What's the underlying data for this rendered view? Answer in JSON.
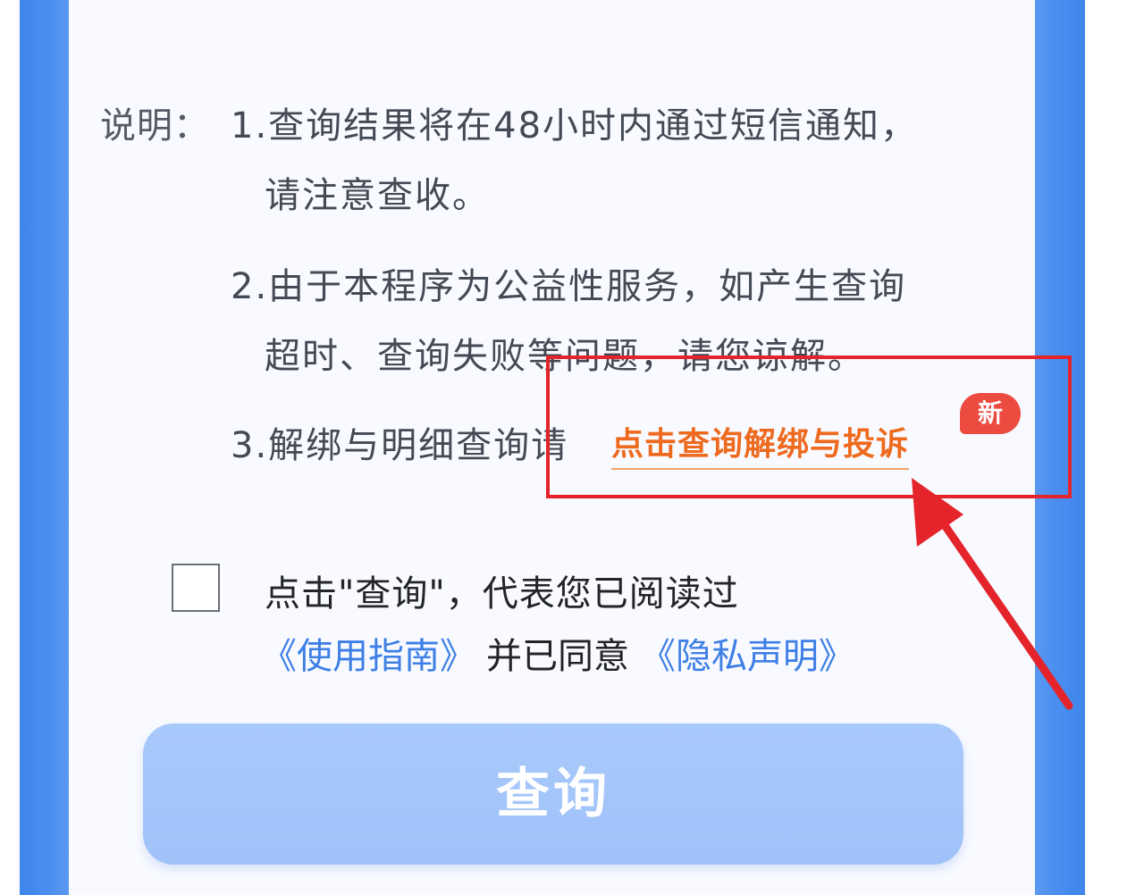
{
  "notes": {
    "label": "说明：",
    "item1_line1": "1.查询结果将在48小时内通过短信通知，",
    "item1_line2": "请注意查收。",
    "item2_line1": "2.由于本程序为公益性服务，如产生查询",
    "item2_line2": "超时、查询失败等问题，请您谅解。",
    "item3_prefix": "3.解绑与明细查询请",
    "item3_link": "点击查询解绑与投诉",
    "new_badge": "新"
  },
  "consent": {
    "line1": "点击\"查询\"，代表您已阅读过",
    "guide_link": "《使用指南》",
    "middle_text": "并已同意",
    "privacy_link": "《隐私声明》",
    "checked": false
  },
  "query_button": {
    "label": "查询"
  },
  "colors": {
    "side_bar": "#4a8ff0",
    "link_orange": "#ee6a1f",
    "badge_red": "#ec4b3f",
    "annotation_red": "#e4232b",
    "doc_link_blue": "#3e7fe6",
    "button_blue": "#a9c9fb"
  },
  "icons": {
    "arrow": "annotation-arrow-icon",
    "checkbox": "checkbox-icon"
  }
}
